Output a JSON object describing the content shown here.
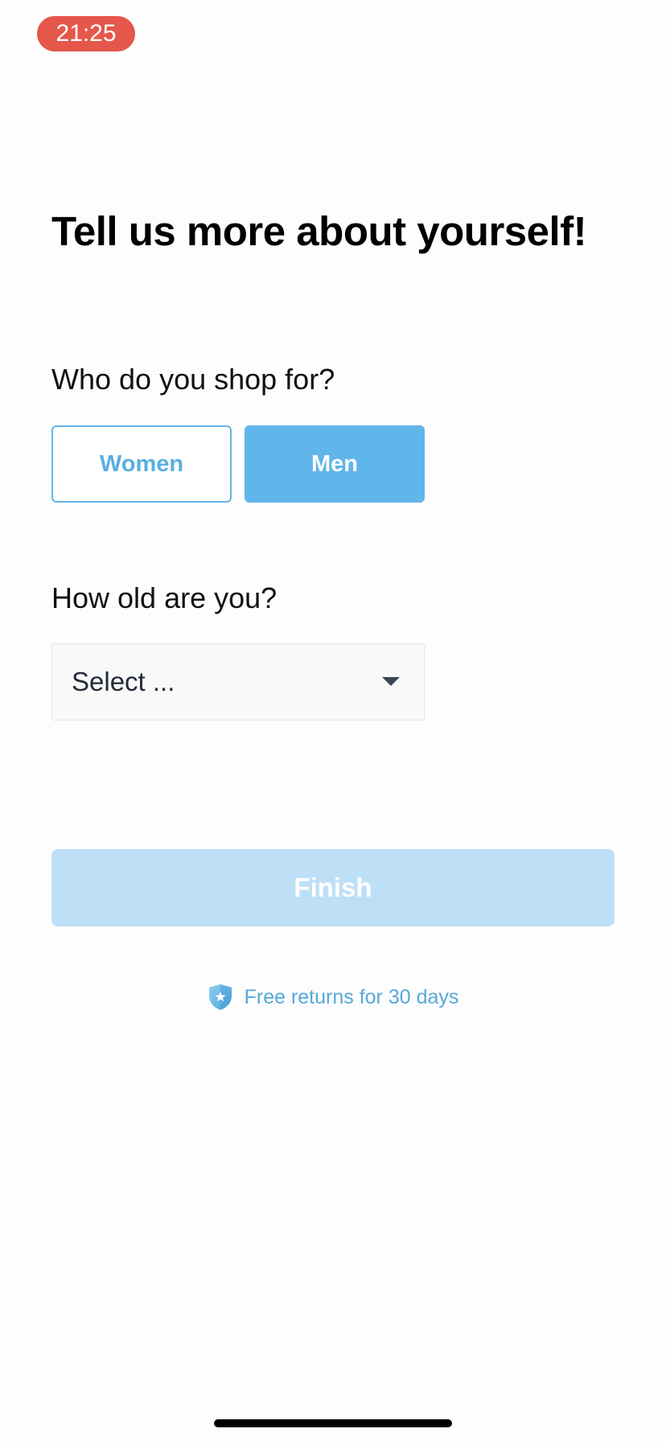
{
  "status_bar": {
    "time": "21:25"
  },
  "title": "Tell us more about yourself!",
  "gender": {
    "question": "Who do you shop for?",
    "options": [
      {
        "label": "Women",
        "selected": false
      },
      {
        "label": "Men",
        "selected": true
      }
    ]
  },
  "age": {
    "question": "How old are you?",
    "select_value": "Select ...",
    "caret_icon": "caret-down-icon"
  },
  "finish": {
    "label": "Finish",
    "enabled": false
  },
  "returns": {
    "icon": "shield-star-icon",
    "text": "Free returns for 30 days"
  },
  "colors": {
    "accent": "#60b5ea",
    "finish_disabled": "#bde0f6",
    "time_pill": "#e5574b",
    "returns_text": "#55a9d8"
  }
}
